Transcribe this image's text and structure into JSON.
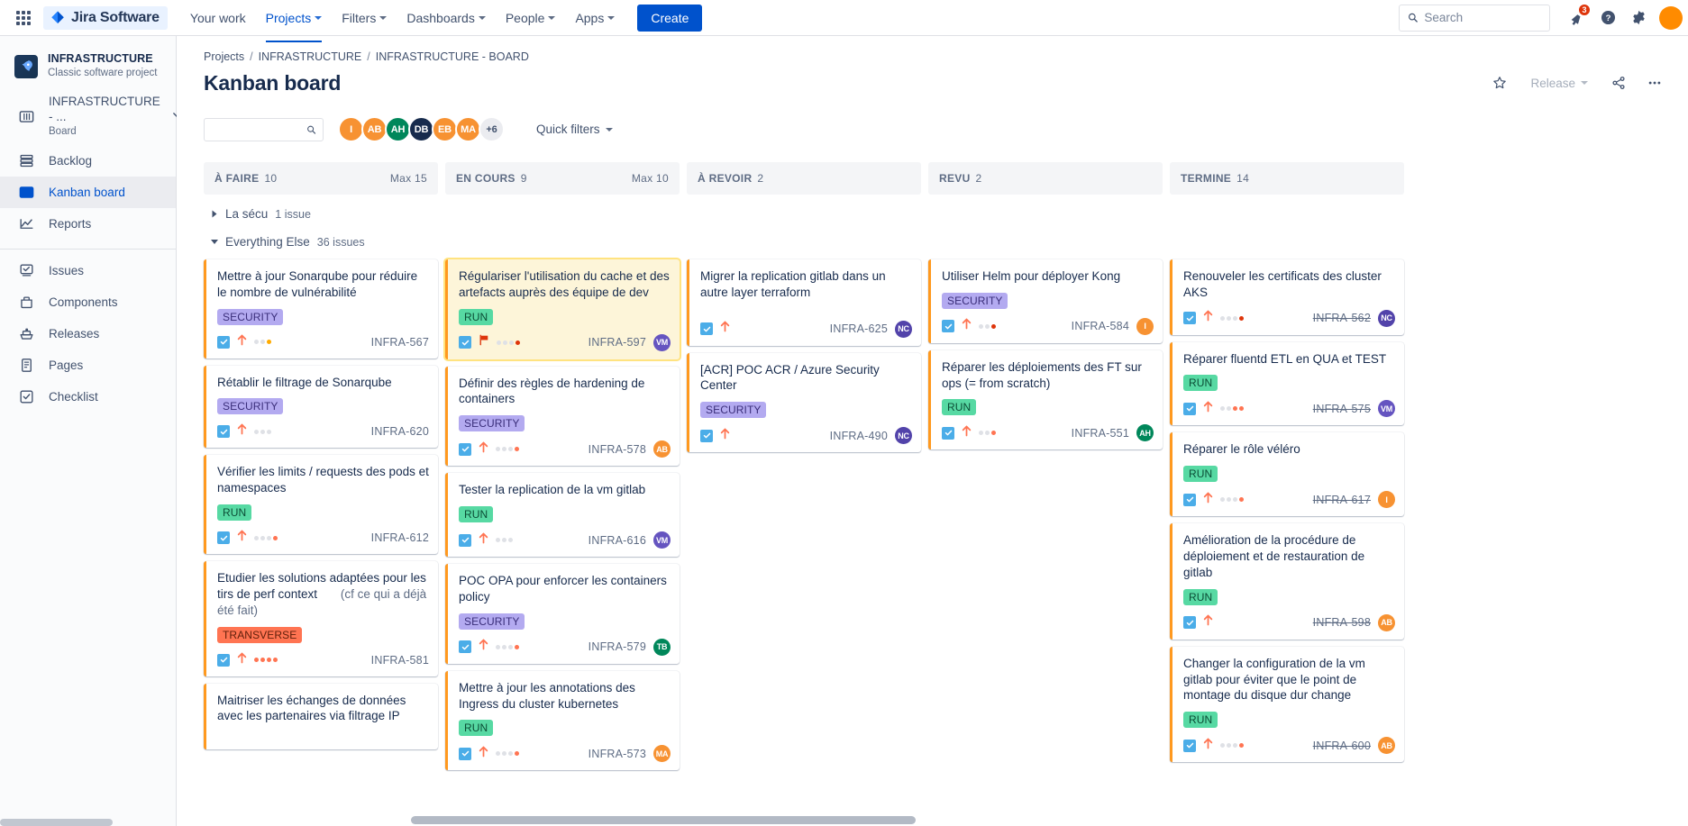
{
  "topnav": {
    "app_switcher_icon": "grid-apps-icon",
    "brand": "Jira Software",
    "brand_logo_icon": "jira-diamond-icon",
    "items": [
      {
        "label": "Your work",
        "has_caret": false,
        "active": false
      },
      {
        "label": "Projects",
        "has_caret": true,
        "active": true
      },
      {
        "label": "Filters",
        "has_caret": true,
        "active": false
      },
      {
        "label": "Dashboards",
        "has_caret": true,
        "active": false
      },
      {
        "label": "People",
        "has_caret": true,
        "active": false
      },
      {
        "label": "Apps",
        "has_caret": true,
        "active": false
      }
    ],
    "create_label": "Create",
    "search_placeholder": "Search",
    "search_value": "",
    "search_icon": "search-icon",
    "notifications_icon": "megaphone-icon",
    "notifications_count": "3",
    "help_icon": "help-circle-icon",
    "settings_icon": "gear-icon",
    "profile_icon": "user-avatar"
  },
  "sidebar": {
    "project": {
      "name": "INFRASTRUCTURE",
      "subtitle": "Classic software project",
      "icon": "rocket-icon"
    },
    "board_item": {
      "title": "INFRASTRUCTURE - ...",
      "subtitle": "Board",
      "icon": "board-columns-icon",
      "chevron": "chevron-down-icon"
    },
    "items": [
      {
        "label": "Backlog",
        "icon": "backlog-icon",
        "selected": false
      },
      {
        "label": "Kanban board",
        "icon": "board-columns-icon",
        "selected": true
      },
      {
        "label": "Reports",
        "icon": "reports-chart-icon",
        "selected": false
      }
    ],
    "items2": [
      {
        "label": "Issues",
        "icon": "issues-icon",
        "selected": false
      },
      {
        "label": "Components",
        "icon": "components-icon",
        "selected": false
      },
      {
        "label": "Releases",
        "icon": "releases-ship-icon",
        "selected": false
      },
      {
        "label": "Pages",
        "icon": "pages-doc-icon",
        "selected": false
      },
      {
        "label": "Checklist",
        "icon": "checklist-icon",
        "selected": false
      }
    ]
  },
  "header": {
    "breadcrumb": [
      "Projects",
      "INFRASTRUCTURE",
      "INFRASTRUCTURE - BOARD"
    ],
    "title": "Kanban board",
    "star_icon": "star-outline-icon",
    "release_label": "Release",
    "release_caret": "chevron-down-icon",
    "share_icon": "share-icon",
    "more_icon": "more-ellipsis-icon"
  },
  "filterbar": {
    "search_value": "",
    "search_icon": "search-icon",
    "avatars": [
      {
        "initials": "I",
        "color": "#f79232"
      },
      {
        "initials": "AB",
        "color": "#f79232"
      },
      {
        "initials": "AH",
        "color": "#00875a"
      },
      {
        "initials": "DB",
        "color": "#172b4d"
      },
      {
        "initials": "EB",
        "color": "#f79232"
      },
      {
        "initials": "MA",
        "color": "#f79232"
      },
      {
        "initials": "+6",
        "color": "#ebecf0"
      }
    ],
    "quick_filters_label": "Quick filters",
    "quick_filters_caret": "chevron-down-icon"
  },
  "board": {
    "columns": [
      {
        "name": "À FAIRE",
        "count": "10",
        "max": "Max 15"
      },
      {
        "name": "EN COURS",
        "count": "9",
        "max": "Max 10"
      },
      {
        "name": "À REVOIR",
        "count": "2",
        "max": ""
      },
      {
        "name": "REVU",
        "count": "2",
        "max": ""
      },
      {
        "name": "TERMINE",
        "count": "14",
        "max": ""
      }
    ],
    "swimlanes": [
      {
        "name": "La sécu",
        "count": "1 issue",
        "collapsed": true
      },
      {
        "name": "Everything Else",
        "count": "36 issues",
        "collapsed": false
      }
    ],
    "cards": {
      "todo": [
        {
          "title": "Mettre à jour Sonarqube pour réduire le nombre de vulnérabilité",
          "labels": [
            {
              "text": "SECURITY",
              "type": "security"
            }
          ],
          "priority": "arrow-up-icon",
          "dots": [
            "off",
            "off",
            "yellow"
          ],
          "key": "INFRA-567",
          "done": false,
          "avatar": null,
          "selected": false
        },
        {
          "title": "Rétablir le filtrage de Sonarqube",
          "labels": [
            {
              "text": "SECURITY",
              "type": "security"
            }
          ],
          "priority": "arrow-up-icon",
          "dots": [
            "off",
            "off",
            "off"
          ],
          "key": "INFRA-620",
          "done": false,
          "avatar": null,
          "selected": false
        },
        {
          "title": "Vérifier les limits / requests des pods et namespaces",
          "labels": [
            {
              "text": "RUN",
              "type": "run"
            }
          ],
          "priority": "arrow-up-icon",
          "dots": [
            "off",
            "off",
            "off",
            "orange"
          ],
          "key": "INFRA-612",
          "done": false,
          "avatar": null,
          "selected": false
        },
        {
          "title": "Etudier les solutions adaptées pour les tirs de perf context",
          "title_muted": "(cf ce qui a déjà été fait)",
          "labels": [
            {
              "text": "TRANSVERSE",
              "type": "transverse"
            }
          ],
          "priority": "arrow-up-icon",
          "dots": [
            "orange",
            "orange",
            "orange",
            "orange"
          ],
          "key": "INFRA-581",
          "done": false,
          "avatar": null,
          "selected": false
        },
        {
          "title": "Maitriser les échanges de données avec les partenaires via filtrage IP",
          "labels": [],
          "priority": "arrow-up-icon",
          "dots": [],
          "key": "",
          "done": false,
          "avatar": null,
          "selected": false
        }
      ],
      "inprogress": [
        {
          "title": "Régulariser l'utilisation du cache et des artefacts auprès des équipe de dev",
          "labels": [
            {
              "text": "RUN",
              "type": "run"
            }
          ],
          "priority": "red-flag-icon",
          "dots": [
            "off",
            "off",
            "off",
            "red"
          ],
          "key": "INFRA-597",
          "done": false,
          "avatar": {
            "initials": "VM",
            "color": "#6554c0"
          },
          "selected": true
        },
        {
          "title": "Définir des règles de hardening de containers",
          "labels": [
            {
              "text": "SECURITY",
              "type": "security"
            }
          ],
          "priority": "arrow-up-icon",
          "dots": [
            "off",
            "off",
            "off",
            "orange"
          ],
          "key": "INFRA-578",
          "done": false,
          "avatar": {
            "initials": "AB",
            "color": "#f79232"
          },
          "selected": false
        },
        {
          "title": "Tester la replication de la vm gitlab",
          "labels": [
            {
              "text": "RUN",
              "type": "run"
            }
          ],
          "priority": "arrow-up-icon",
          "dots": [
            "off",
            "off",
            "off"
          ],
          "key": "INFRA-616",
          "done": false,
          "avatar": {
            "initials": "VM",
            "color": "#6554c0"
          },
          "selected": false
        },
        {
          "title": "POC OPA pour enforcer les containers policy",
          "labels": [
            {
              "text": "SECURITY",
              "type": "security"
            }
          ],
          "priority": "arrow-up-icon",
          "dots": [
            "off",
            "off",
            "off",
            "orange"
          ],
          "key": "INFRA-579",
          "done": false,
          "avatar": {
            "initials": "TB",
            "color": "#00875a"
          },
          "selected": false
        },
        {
          "title": "Mettre à jour les annotations des Ingress du cluster kubernetes",
          "labels": [
            {
              "text": "RUN",
              "type": "run"
            }
          ],
          "priority": "arrow-up-icon",
          "dots": [
            "off",
            "off",
            "off",
            "orange"
          ],
          "key": "INFRA-573",
          "done": false,
          "avatar": {
            "initials": "MA",
            "color": "#f79232"
          },
          "selected": false
        }
      ],
      "review": [
        {
          "title": "Migrer la replication gitlab dans un autre layer terraform",
          "labels": [],
          "priority": "arrow-up-icon",
          "dots": [],
          "key": "INFRA-625",
          "done": false,
          "avatar": {
            "initials": "NC",
            "color": "#5243aa"
          },
          "selected": false
        },
        {
          "title": "[ACR] POC ACR / Azure Security Center",
          "labels": [
            {
              "text": "SECURITY",
              "type": "security"
            }
          ],
          "priority": "arrow-up-icon",
          "dots": [],
          "key": "INFRA-490",
          "done": false,
          "avatar": {
            "initials": "NC",
            "color": "#5243aa"
          },
          "selected": false
        }
      ],
      "revu": [
        {
          "title": "Utiliser Helm pour déployer Kong",
          "labels": [
            {
              "text": "SECURITY",
              "type": "security"
            }
          ],
          "priority": "arrow-up-icon",
          "dots": [
            "off",
            "off",
            "red"
          ],
          "key": "INFRA-584",
          "done": false,
          "avatar": {
            "initials": "I",
            "color": "#f79232"
          },
          "selected": false
        },
        {
          "title": "Réparer les déploiements des FT sur ops (= from scratch)",
          "labels": [
            {
              "text": "RUN",
              "type": "run"
            }
          ],
          "priority": "arrow-up-icon",
          "dots": [
            "off",
            "off",
            "orange"
          ],
          "key": "INFRA-551",
          "done": false,
          "avatar": {
            "initials": "AH",
            "color": "#00875a"
          },
          "selected": false
        }
      ],
      "done": [
        {
          "title": "Renouveler les certificats des cluster AKS",
          "labels": [],
          "priority": "arrow-up-icon",
          "dots": [
            "off",
            "off",
            "off",
            "red"
          ],
          "key": "INFRA-562",
          "done": true,
          "avatar": {
            "initials": "NC",
            "color": "#5243aa"
          },
          "selected": false
        },
        {
          "title": "Réparer fluentd ETL en QUA et TEST",
          "labels": [
            {
              "text": "RUN",
              "type": "run"
            }
          ],
          "priority": "arrow-up-icon",
          "dots": [
            "off",
            "off",
            "orange",
            "orange"
          ],
          "key": "INFRA-575",
          "done": true,
          "avatar": {
            "initials": "VM",
            "color": "#6554c0"
          },
          "selected": false
        },
        {
          "title": "Réparer le rôle véléro",
          "labels": [
            {
              "text": "RUN",
              "type": "run"
            }
          ],
          "priority": "arrow-up-icon",
          "dots": [
            "off",
            "off",
            "off",
            "orange"
          ],
          "key": "INFRA-617",
          "done": true,
          "avatar": {
            "initials": "I",
            "color": "#f79232"
          },
          "selected": false
        },
        {
          "title": "Amélioration de la procédure de déploiement et de restauration de gitlab",
          "labels": [
            {
              "text": "RUN",
              "type": "run"
            }
          ],
          "priority": "arrow-up-icon",
          "dots": [],
          "key": "INFRA-598",
          "done": true,
          "avatar": {
            "initials": "AB",
            "color": "#f79232"
          },
          "selected": false
        },
        {
          "title": "Changer la configuration de la vm gitlab pour éviter que le point de montage du disque dur change",
          "labels": [
            {
              "text": "RUN",
              "type": "run"
            }
          ],
          "priority": "arrow-up-icon",
          "dots": [
            "off",
            "off",
            "off",
            "orange"
          ],
          "key": "INFRA-600",
          "done": true,
          "avatar": {
            "initials": "AB",
            "color": "#f79232"
          },
          "selected": false
        }
      ]
    }
  }
}
